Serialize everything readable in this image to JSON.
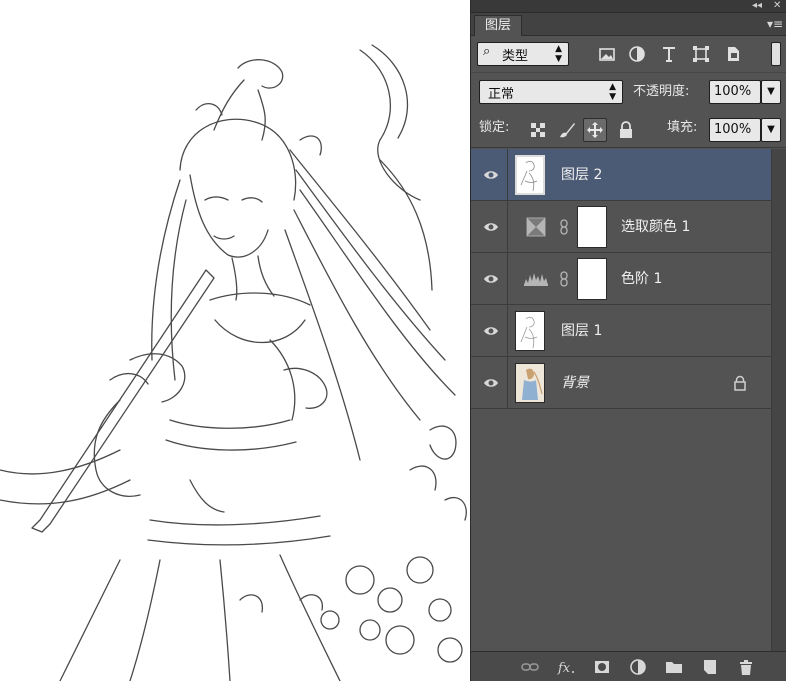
{
  "panel": {
    "tab_label": "图层",
    "collapse_glyph": "◂◂",
    "close_glyph": "✕",
    "menu_glyph": "▾≡"
  },
  "filter": {
    "search_glyph": "⌕",
    "kind_label": "类型",
    "icons": [
      "image-filter-icon",
      "adjustment-filter-icon",
      "type-filter-icon",
      "shape-filter-icon",
      "smart-object-filter-icon"
    ]
  },
  "blend": {
    "mode": "正常",
    "opacity_label": "不透明度:",
    "opacity_value": "100%"
  },
  "lock": {
    "label": "锁定:",
    "fill_label": "填充:",
    "fill_value": "100%"
  },
  "layers": [
    {
      "name": "图层 2",
      "kind": "pixel",
      "selected": true
    },
    {
      "name": "选取颜色 1",
      "kind": "adjustment-selective-color",
      "selected": false
    },
    {
      "name": "色阶 1",
      "kind": "adjustment-levels",
      "selected": false
    },
    {
      "name": "图层 1",
      "kind": "pixel",
      "selected": false
    },
    {
      "name": "背景",
      "kind": "background",
      "selected": false,
      "locked": true
    }
  ],
  "bottom_toolbar": [
    "link-layers-icon",
    "fx-icon",
    "add-mask-icon",
    "new-adjustment-icon",
    "new-group-icon",
    "new-layer-icon",
    "trash-icon"
  ],
  "colors": {
    "panel_bg": "#535353",
    "selected_row": "#4c5b75"
  }
}
